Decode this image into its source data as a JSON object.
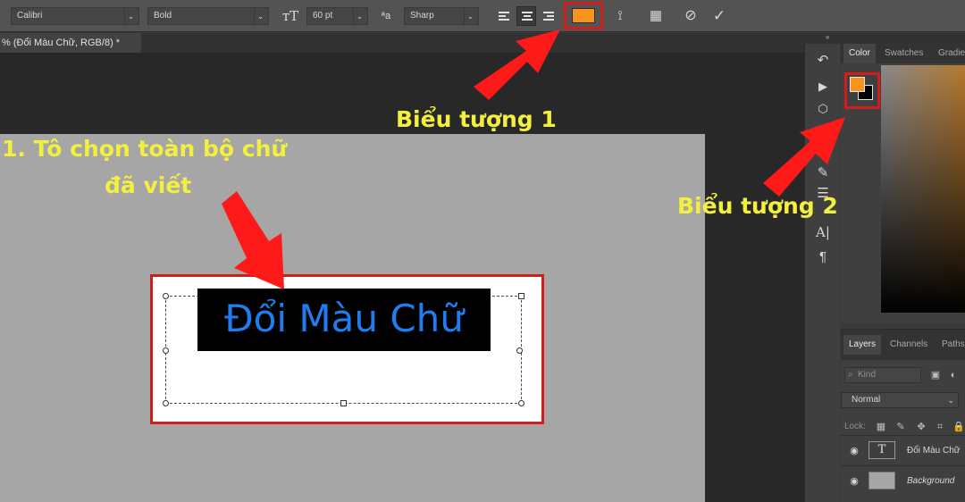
{
  "options_bar": {
    "font_family": "Calibri",
    "font_style": "Bold",
    "font_size": "60 pt",
    "aa_label": "ªa",
    "antialias": "Sharp",
    "text_color": "#f7941d",
    "icons": [
      "text-orientation-icon",
      "font-size-icon",
      "antialias-icon",
      "align-left-icon",
      "align-center-icon",
      "align-right-icon",
      "text-color-swatch",
      "warp-text-icon",
      "character-panel-icon",
      "cancel-icon",
      "commit-icon"
    ]
  },
  "document": {
    "tab_title": "% (Đổi Màu Chữ, RGB/8) *",
    "text_content": "Đổi Màu Chữ",
    "text_color": "#1e7df0"
  },
  "annotations": {
    "step_1_line1": "1. Tô chọn toàn bộ chữ",
    "step_1_line2": "đã viết",
    "icon_1_label": "Biểu tượng 1",
    "icon_2_label": "Biểu tượng 2",
    "highlight_color": "#d21d1d",
    "label_color": "#f3ef3f"
  },
  "panels": {
    "collapse": "«",
    "color_tabs": [
      "Color",
      "Swatches",
      "Gradie"
    ],
    "foreground_color": "#f7941d",
    "background_color": "#000000",
    "layers_tabs": [
      "Layers",
      "Channels",
      "Paths"
    ],
    "kind_placeholder": "Kind",
    "blend_mode": "Normal",
    "lock_label": "Lock:",
    "layers": [
      {
        "name": "Đổi Màu Chữ",
        "type": "text"
      },
      {
        "name": "Background",
        "type": "image"
      }
    ]
  },
  "tools": [
    "history-icon",
    "play-icon",
    "3d-icon",
    "brush-settings-icon",
    "adjust-icon",
    "character-icon",
    "paragraph-icon"
  ]
}
